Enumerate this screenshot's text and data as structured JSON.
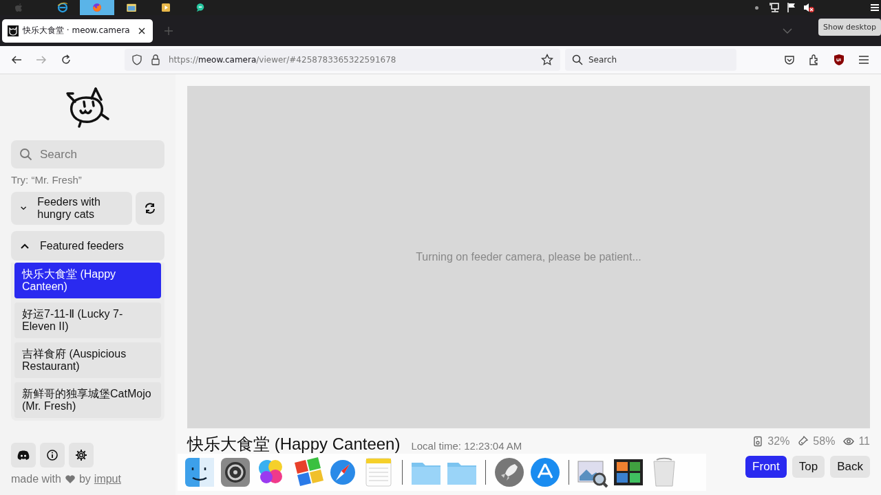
{
  "taskbar": {
    "apps": [
      {
        "kind": "apple",
        "selected": false
      },
      {
        "kind": "ie",
        "selected": false
      },
      {
        "kind": "firefox",
        "selected": true
      },
      {
        "kind": "files",
        "selected": false
      },
      {
        "kind": "media",
        "selected": false
      },
      {
        "kind": "chat",
        "selected": false
      }
    ],
    "tooltip": "Show desktop"
  },
  "browser": {
    "tab": {
      "title": "快乐大食堂 · meow.camera"
    },
    "url": {
      "scheme": "https://",
      "host": "meow.camera",
      "path": "/viewer/#4258783365322591678"
    },
    "search": {
      "placeholder": "Search"
    }
  },
  "sidebar": {
    "search": {
      "placeholder": "Search"
    },
    "hint": "Try: “Mr. Fresh”",
    "sections": [
      {
        "label": "Feeders with hungry cats",
        "expanded": false,
        "refresh": true
      },
      {
        "label": "Featured feeders",
        "expanded": true,
        "refresh": false,
        "items": [
          {
            "label": "快乐大食堂 (Happy Canteen)",
            "selected": true
          },
          {
            "label": "好运7-11-Ⅱ (Lucky 7-Eleven II)",
            "selected": false
          },
          {
            "label": "吉祥食府 (Auspicious Restaurant)",
            "selected": false
          },
          {
            "label": "新鲜哥的独享城堡CatMojo (Mr. Fresh)",
            "selected": false
          }
        ]
      }
    ],
    "footer": {
      "prefix": "made with",
      "middle": "by",
      "link": "imput"
    }
  },
  "viewer": {
    "status": "Turning on feeder camera, please be patient...",
    "title": "快乐大食堂 (Happy Canteen)",
    "local_time": "Local time: 12:23:04 AM",
    "stats": [
      {
        "kind": "storage",
        "value": "32%"
      },
      {
        "kind": "food",
        "value": "58%"
      },
      {
        "kind": "viewers",
        "value": "11"
      }
    ],
    "views": [
      {
        "label": "Front",
        "selected": true
      },
      {
        "label": "Top",
        "selected": false
      },
      {
        "label": "Back",
        "selected": false
      }
    ]
  },
  "dock": {
    "apps": [
      {
        "kind": "finder"
      },
      {
        "kind": "settings"
      },
      {
        "kind": "bubbles"
      },
      {
        "kind": "flag"
      },
      {
        "kind": "compass"
      },
      {
        "kind": "notes"
      },
      {
        "kind": "separator"
      },
      {
        "kind": "folder"
      },
      {
        "kind": "folder"
      },
      {
        "kind": "separator"
      },
      {
        "kind": "rocket"
      },
      {
        "kind": "store"
      },
      {
        "kind": "separator"
      },
      {
        "kind": "preview"
      },
      {
        "kind": "photos"
      },
      {
        "kind": "trash"
      }
    ]
  }
}
